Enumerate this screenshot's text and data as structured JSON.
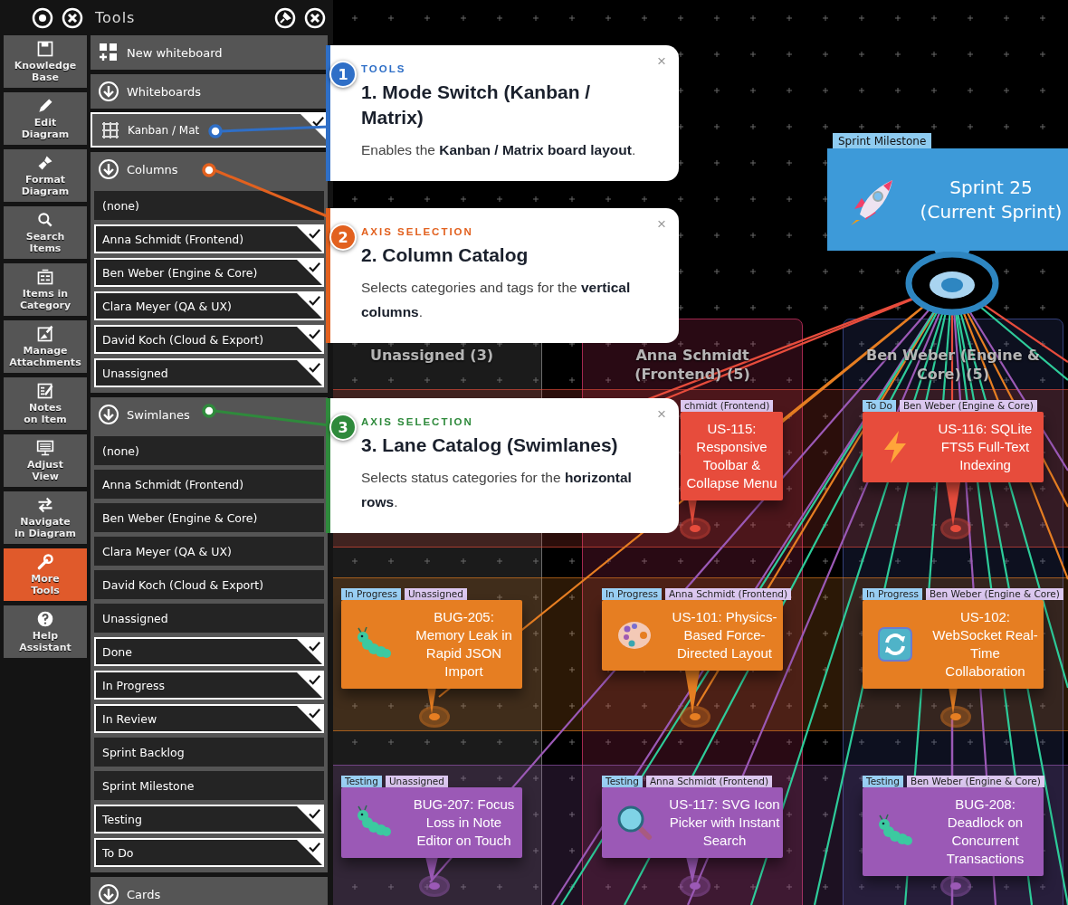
{
  "panel": {
    "title": "Tools"
  },
  "tool_buttons": [
    {
      "label": "Knowledge\nBase",
      "selected": false
    },
    {
      "label": "Edit\nDiagram",
      "selected": false
    },
    {
      "label": "Format\nDiagram",
      "selected": false
    },
    {
      "label": "Search\nItems",
      "selected": false
    },
    {
      "label": "Items in\nCategory",
      "selected": false
    },
    {
      "label": "Manage\nAttachments",
      "selected": false
    },
    {
      "label": "Notes\non Item",
      "selected": false
    },
    {
      "label": "Adjust\nView",
      "selected": false
    },
    {
      "label": "Navigate\nin Diagram",
      "selected": false
    },
    {
      "label": "More\nTools",
      "selected": true
    },
    {
      "label": "Help\nAssistant",
      "selected": false
    }
  ],
  "menu": [
    {
      "kind": "action",
      "label": "New whiteboard"
    },
    {
      "kind": "section",
      "label": "Whiteboards"
    },
    {
      "kind": "mode",
      "label": "Kanban / Mat",
      "checked": true
    },
    {
      "kind": "section",
      "label": "Columns",
      "items": [
        {
          "label": "(none)",
          "checked": false
        },
        {
          "label": "Anna Schmidt (Frontend)",
          "checked": true
        },
        {
          "label": "Ben Weber (Engine & Core)",
          "checked": true
        },
        {
          "label": "Clara Meyer (QA & UX)",
          "checked": true
        },
        {
          "label": "David Koch (Cloud & Export)",
          "checked": true
        },
        {
          "label": "Unassigned",
          "checked": true
        }
      ]
    },
    {
      "kind": "section",
      "label": "Swimlanes",
      "items": [
        {
          "label": "(none)",
          "checked": false
        },
        {
          "label": "Anna Schmidt (Frontend)",
          "checked": false
        },
        {
          "label": "Ben Weber (Engine & Core)",
          "checked": false
        },
        {
          "label": "Clara Meyer (QA & UX)",
          "checked": false
        },
        {
          "label": "David Koch (Cloud & Export)",
          "checked": false
        },
        {
          "label": "Unassigned",
          "checked": false
        },
        {
          "label": "Done",
          "checked": true
        },
        {
          "label": "In Progress",
          "checked": true
        },
        {
          "label": "In Review",
          "checked": true
        },
        {
          "label": "Sprint Backlog",
          "checked": false
        },
        {
          "label": "Sprint Milestone",
          "checked": false
        },
        {
          "label": "Testing",
          "checked": true
        },
        {
          "label": "To Do",
          "checked": true
        }
      ]
    },
    {
      "kind": "section",
      "label": "Cards"
    }
  ],
  "board": {
    "columns": [
      {
        "title": "Unassigned (3)",
        "color": "#6b6b6b"
      },
      {
        "title": "Anna Schmidt (Frontend) (5)",
        "color": "#a3284f"
      },
      {
        "title": "Ben Weber (Engine & Core) (5)",
        "color": "#34407a"
      }
    ],
    "milestone": {
      "tag": "Sprint Milestone",
      "title": "Sprint 25 (Current Sprint)"
    },
    "lanes": [
      {
        "color": "#e74c3c",
        "cards": [
          {
            "title": "US-115: Responsive Toolbar & Collapse Menu",
            "covered": true,
            "tags": [
              {
                "kind": "owner",
                "text": "chmidt (Frontend)"
              }
            ]
          },
          {
            "title": "US-116: SQLite FTS5 Full-Text Indexing",
            "covered": false,
            "tags": [
              {
                "kind": "status",
                "text": "To Do"
              },
              {
                "kind": "owner",
                "text": "Ben Weber (Engine & Core)"
              }
            ]
          }
        ]
      },
      {
        "color": "#e67e22",
        "cards": [
          {
            "title": "BUG-205: Memory Leak in Rapid JSON Import",
            "covered": false,
            "tags": [
              {
                "kind": "status",
                "text": "In Progress"
              },
              {
                "kind": "owner",
                "text": "Unassigned"
              }
            ]
          },
          {
            "title": "US-101: Physics-Based Force-Directed Layout",
            "covered": false,
            "tags": [
              {
                "kind": "status",
                "text": "In Progress"
              },
              {
                "kind": "owner",
                "text": "Anna Schmidt (Frontend)"
              }
            ]
          },
          {
            "title": "US-102: WebSocket Real-Time Collaboration",
            "covered": false,
            "tags": [
              {
                "kind": "status",
                "text": "In Progress"
              },
              {
                "kind": "owner",
                "text": "Ben Weber (Engine & Core)"
              }
            ]
          }
        ]
      },
      {
        "color": "#9b59b6",
        "cards": [
          {
            "title": "BUG-207: Focus Loss in Note Editor on Touch",
            "covered": false,
            "tags": [
              {
                "kind": "status",
                "text": "Testing"
              },
              {
                "kind": "owner",
                "text": "Unassigned"
              }
            ]
          },
          {
            "title": "US-117: SVG Icon Picker with Instant Search",
            "covered": false,
            "tags": [
              {
                "kind": "status",
                "text": "Testing"
              },
              {
                "kind": "owner",
                "text": "Anna Schmidt (Frontend)"
              }
            ]
          },
          {
            "title": "BUG-208: Deadlock on Concurrent Transactions",
            "covered": false,
            "tags": [
              {
                "kind": "status",
                "text": "Testing"
              },
              {
                "kind": "owner",
                "text": "Ben Weber (Engine & Core)"
              }
            ]
          }
        ]
      }
    ]
  },
  "callouts": [
    {
      "number": "1",
      "color": "#2f6fc7",
      "category": "TOOLS",
      "title": "1. Mode Switch (Kanban / Matrix)",
      "text": "Enables the **Kanban / Matrix board layout**.",
      "close": "×"
    },
    {
      "number": "2",
      "color": "#e2611f",
      "category": "AXIS SELECTION",
      "title": "2. Column Catalog",
      "text": "Selects categories and tags for the **vertical columns**.",
      "close": "×"
    },
    {
      "number": "3",
      "color": "#2f8a3c",
      "category": "AXIS SELECTION",
      "title": "3. Lane Catalog (Swimlanes)",
      "text": "Selects status categories for the **horizontal rows**.",
      "close": "×"
    }
  ]
}
